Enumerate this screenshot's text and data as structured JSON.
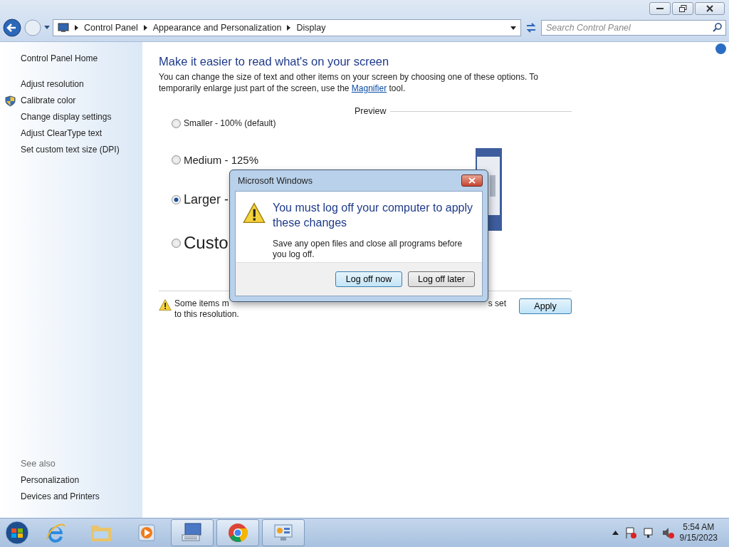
{
  "address_bar": {
    "breadcrumbs": [
      "Control Panel",
      "Appearance and Personalization",
      "Display"
    ]
  },
  "search": {
    "placeholder": "Search Control Panel"
  },
  "sidebar": {
    "home": "Control Panel Home",
    "items": [
      {
        "label": "Adjust resolution",
        "shield": false
      },
      {
        "label": "Calibrate color",
        "shield": true
      },
      {
        "label": "Change display settings",
        "shield": false
      },
      {
        "label": "Adjust ClearType text",
        "shield": false
      },
      {
        "label": "Set custom text size (DPI)",
        "shield": false
      }
    ],
    "see_also": {
      "heading": "See also",
      "items": [
        "Personalization",
        "Devices and Printers"
      ]
    }
  },
  "main": {
    "title": "Make it easier to read what's on your screen",
    "intro": "You can change the size of text and other items on your screen by choosing one of these options. To temporarily enlarge just part of the screen, use the",
    "link": "Magnifier",
    "intro_end": "tool.",
    "options": [
      {
        "label": "Smaller - 100% (default)",
        "kind": "small",
        "selected": false
      },
      {
        "label": "Medium - 125%",
        "kind": "medium",
        "selected": false
      },
      {
        "label": "Larger -",
        "kind": "large",
        "selected": true
      },
      {
        "label": "Custo",
        "kind": "huge",
        "selected": false
      }
    ],
    "preview_label": "Preview",
    "warning": [
      "Some items m",
      "s set",
      "to this resolution."
    ],
    "apply": "Apply"
  },
  "dialog": {
    "title": "Microsoft Windows",
    "heading": "You must log off your computer to apply these changes",
    "body": "Save any open files and close all programs before you log off.",
    "buttons": [
      {
        "label": "Log off now",
        "default": true
      },
      {
        "label": "Log off later",
        "default": false
      }
    ]
  },
  "taskbar": {
    "items": [
      {
        "kind": "browser-e",
        "open": false
      },
      {
        "kind": "folder",
        "open": false
      },
      {
        "kind": "media",
        "open": false
      },
      {
        "kind": "keyboard",
        "open": true
      },
      {
        "kind": "chrome",
        "open": true
      },
      {
        "kind": "panel",
        "open": true
      }
    ],
    "clock": {
      "time": "5:54 AM",
      "date": "9/15/2023"
    }
  }
}
